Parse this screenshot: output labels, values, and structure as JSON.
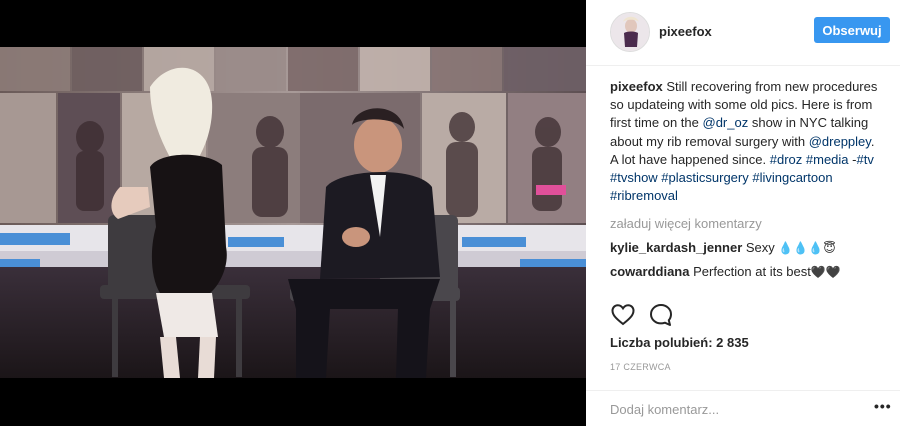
{
  "post": {
    "username": "pixeefox",
    "follow_label": "Obserwuj",
    "caption": {
      "username": "pixeefox",
      "text_1": "Still recovering from new procedures so updateing with some old pics. Here is from first time on the",
      "mention_1": "@dr_oz",
      "text_2": "show in NYC talking about my rib removal surgery with",
      "mention_2": "@dreppley",
      "text_3": ". A lot have happened since.",
      "hashtags_1": "#droz #media",
      "text_4": "-",
      "hashtags_2": "#tv #tvshow #plasticsurgery #livingcartoon #ribremoval"
    },
    "load_more_label": "załaduj więcej komentarzy",
    "comments": [
      {
        "username": "kylie_kardash_jenner",
        "text": "Sexy",
        "emoji": "💧💧💧😇"
      },
      {
        "username": "cowarddiana",
        "text": "Perfection at its best",
        "emoji": "🖤🖤"
      }
    ],
    "likes_label": "Liczba polubień: 2 835",
    "date_label": "17 czerwca",
    "add_comment_placeholder": "Dodaj komentarz...",
    "more_options_glyph": "•••",
    "icons": {
      "like": "heart-icon",
      "comment": "comment-bubble-icon",
      "options": "more-options-icon"
    },
    "colors": {
      "follow_button": "#3897f0",
      "link": "#003569",
      "muted": "#999999"
    }
  }
}
